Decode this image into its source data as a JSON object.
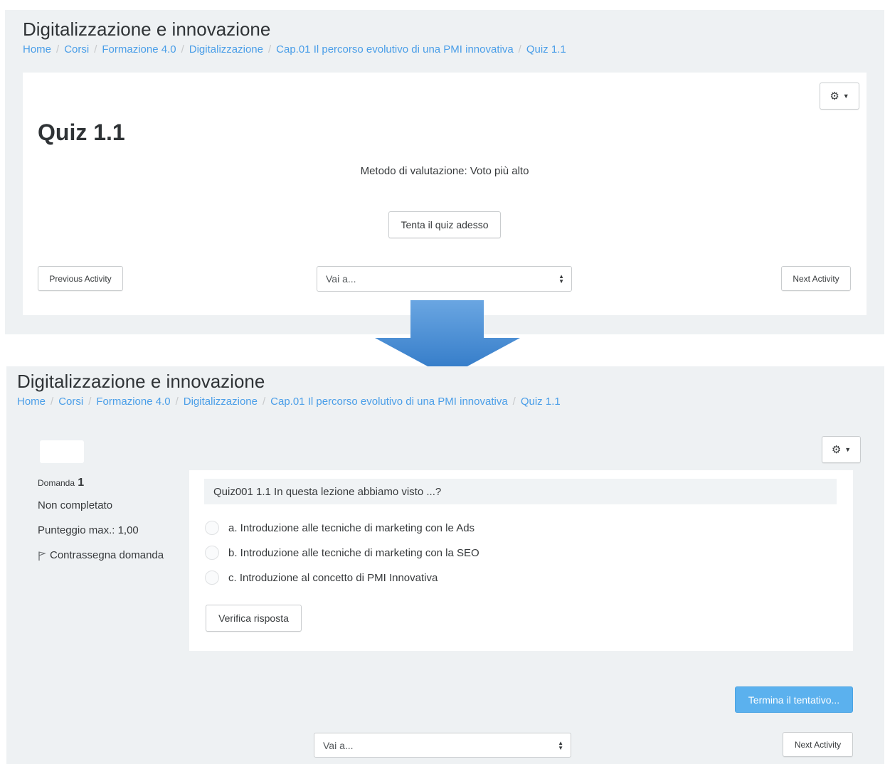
{
  "colors": {
    "panel_bg": "#eef1f3",
    "link": "#4a9ee8",
    "primary": "#5bb1ee",
    "arrow_top": "#6aa6e2",
    "arrow_bottom": "#2f78c6"
  },
  "before": {
    "page_title": "Digitalizzazione e innovazione",
    "breadcrumb": [
      "Home",
      "Corsi",
      "Formazione 4.0",
      "Digitalizzazione",
      "Cap.01 Il percorso evolutivo di una PMI innovativa",
      "Quiz 1.1"
    ],
    "settings_icon": "gear-icon",
    "quiz_title": "Quiz 1.1",
    "grading_method": "Metodo di valutazione: Voto più alto",
    "attempt_button": "Tenta il quiz adesso",
    "previous_activity": "Previous Activity",
    "jump_to": "Vai a...",
    "next_activity": "Next Activity"
  },
  "transition_icon": "arrow-down-icon",
  "after": {
    "page_title": "Digitalizzazione e innovazione",
    "breadcrumb": [
      "Home",
      "Corsi",
      "Formazione 4.0",
      "Digitalizzazione",
      "Cap.01 Il percorso evolutivo di una PMI innovativa",
      "Quiz 1.1"
    ],
    "settings_icon": "gear-icon",
    "question_info": {
      "label": "Domanda",
      "number": "1",
      "state": "Non completato",
      "max_score": "Punteggio max.: 1,00",
      "flag_icon": "flag-icon",
      "flag_label": "Contrassegna domanda"
    },
    "question_text": "Quiz001 1.1 In questa lezione abbiamo visto ...?",
    "answers": [
      "a. Introduzione alle tecniche di marketing con le Ads",
      "b. Introduzione alle tecniche di marketing con la SEO",
      "c. Introduzione al concetto di PMI Innovativa"
    ],
    "check_button": "Verifica risposta",
    "finish_button": "Termina il tentativo...",
    "jump_to": "Vai a...",
    "next_activity": "Next Activity"
  }
}
